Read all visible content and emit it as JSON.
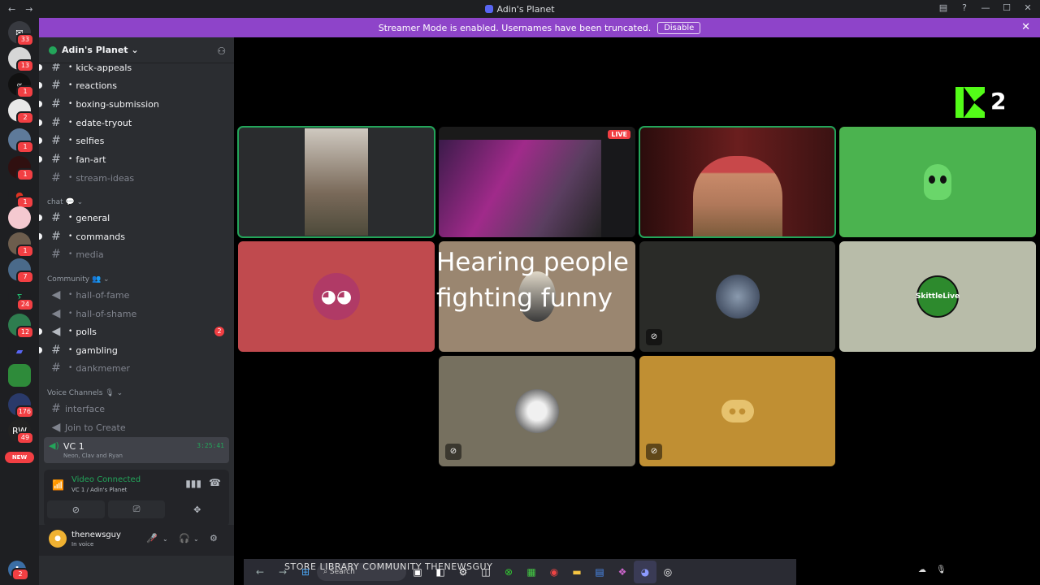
{
  "titlebar": {
    "title": "Adin's Planet",
    "back": "←",
    "forward": "→"
  },
  "banner": {
    "text": "Streamer Mode is enabled. Usernames have been truncated.",
    "disable_label": "Disable",
    "close": "✕"
  },
  "server_rail": {
    "badges": [
      "33",
      "13",
      "1",
      "1",
      "2",
      "1",
      "1",
      "1",
      "1",
      "7",
      "24",
      "12",
      "176",
      "49"
    ],
    "new_label": "NEW",
    "bottom_badge": "2"
  },
  "guild": {
    "name": "Adin's Planet ⌄"
  },
  "channels": [
    {
      "name": "kick-appeals",
      "unread": true
    },
    {
      "name": "reactions",
      "unread": true
    },
    {
      "name": "boxing-submission",
      "unread": true
    },
    {
      "name": "edate-tryout",
      "unread": true
    },
    {
      "name": "selfies",
      "unread": true
    },
    {
      "name": "fan-art",
      "unread": true
    },
    {
      "name": "stream-ideas",
      "unread": false
    }
  ],
  "category_chat": "chat 💬 ⌄",
  "chat_channels": [
    {
      "name": "general",
      "unread": true
    },
    {
      "name": "commands",
      "unread": true
    },
    {
      "name": "media",
      "unread": false
    }
  ],
  "category_community": "Community 👥 ⌄",
  "community_channels": [
    {
      "name": "hall-of-fame",
      "unread": false
    },
    {
      "name": "hall-of-shame",
      "unread": false
    },
    {
      "name": "polls",
      "unread": true,
      "count": "2"
    },
    {
      "name": "gambling",
      "unread": true
    },
    {
      "name": "dankmemer",
      "unread": false
    }
  ],
  "category_voice": "Voice Channels 🎙 ⌄",
  "voice_channels": [
    {
      "name": "interface"
    },
    {
      "name": "Join to Create"
    }
  ],
  "active_vc": {
    "name": "VC 1",
    "timer": "3:25:41",
    "members": "Neon, Clav and Ryan"
  },
  "voice_panel": {
    "status": "Video Connected",
    "location": "VC 1 / Adin's Planet"
  },
  "user": {
    "name": "thenewsguy",
    "status": "In voice"
  },
  "kick": {
    "number": "2"
  },
  "tiles": [
    {
      "color": "#2a2c2e",
      "live": false,
      "speaking": true,
      "content": "webcam-person"
    },
    {
      "color": "#1a1a1a",
      "live": true,
      "speaking": false,
      "content": "stream"
    },
    {
      "color": "#3a1616",
      "live": false,
      "speaking": true,
      "content": "streamer"
    },
    {
      "color": "#4bb34f",
      "live": false,
      "speaking": false,
      "content": "alien"
    },
    {
      "color": "#c04a4e",
      "live": false,
      "speaking": false,
      "content": "discord"
    },
    {
      "color": "#9a8670",
      "live": false,
      "speaking": false,
      "content": "avatar"
    },
    {
      "color": "#2a2b28",
      "live": false,
      "speaking": false,
      "content": "avatar"
    },
    {
      "color": "#b8bca9",
      "live": false,
      "speaking": false,
      "content": "skittle"
    },
    {
      "color": "#76705f",
      "live": false,
      "speaking": false,
      "content": "avatar"
    },
    {
      "color": "#c08f33",
      "live": false,
      "speaking": false,
      "content": "discord"
    }
  ],
  "live_label": "LIVE",
  "skittle_label": "SkittleLive",
  "caption": "Hearing people fighting funny",
  "taskbar": {
    "search_placeholder": "Search",
    "overlay_text": "STORE   LIBRARY   COMMUNITY   THENEWSGUY"
  }
}
